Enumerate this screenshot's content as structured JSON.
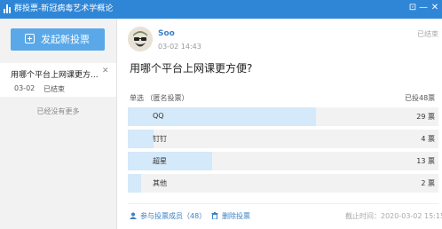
{
  "window": {
    "title": "群投票-新冠病毒艺术学概论",
    "buttons": [
      "⊡",
      "—",
      "✕"
    ]
  },
  "sidebar": {
    "new_vote_label": "发起新投票",
    "items": [
      {
        "title": "用哪个平台上网课更方...",
        "date": "03-02",
        "status": "已结束"
      }
    ],
    "no_more": "已经没有更多"
  },
  "post": {
    "username": "Soo",
    "time": "03-02 14:43",
    "status_tag": "已结束",
    "question": "用哪个平台上网课更方便?",
    "vote_type": "单选  （匿名投票）",
    "total": "已投48票",
    "options": [
      {
        "name": "QQ",
        "count_label": "29 票",
        "votes": 29
      },
      {
        "name": "钉钉",
        "count_label": "4 票",
        "votes": 4
      },
      {
        "name": "超星",
        "count_label": "13 票",
        "votes": 13
      },
      {
        "name": "其他",
        "count_label": "2 票",
        "votes": 2
      }
    ],
    "total_votes": 48
  },
  "footer": {
    "participants_label": "参与投票成员（48）",
    "delete_label": "删除投票",
    "deadline": "截止时间：2020-03-02 15:15"
  },
  "colors": {
    "accent": "#2f86d6",
    "button": "#5aa8e8",
    "bar_fill": "#d4e9f9",
    "link": "#3b82c4"
  }
}
